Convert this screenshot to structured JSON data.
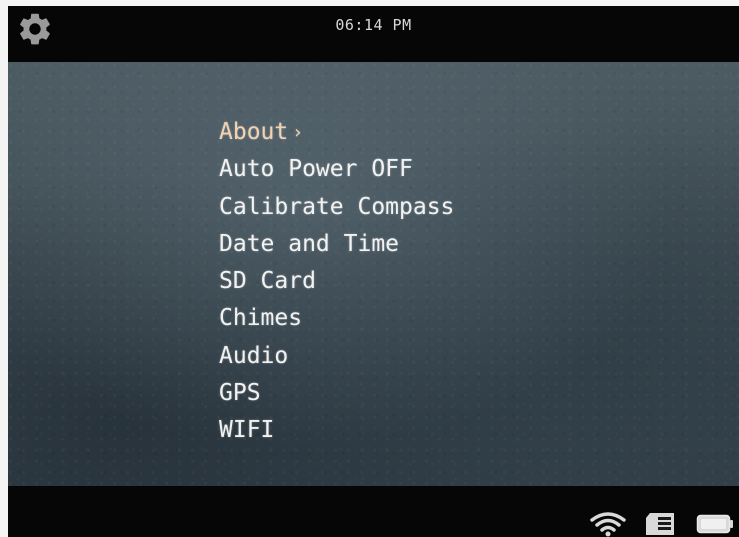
{
  "statusbar": {
    "time": "06:14 PM",
    "settings_icon": "gear-icon"
  },
  "menu": {
    "items": [
      {
        "label": "About",
        "selected": true,
        "indicator": "›"
      },
      {
        "label": "Auto Power OFF"
      },
      {
        "label": "Calibrate Compass"
      },
      {
        "label": "Date and Time"
      },
      {
        "label": "SD Card"
      },
      {
        "label": "Chimes"
      },
      {
        "label": "Audio"
      },
      {
        "label": "GPS"
      },
      {
        "label": "WIFI"
      }
    ],
    "selected_color": "#f1d3b3",
    "item_color": "#f2f2f2"
  },
  "bottom_status": {
    "icons": [
      "wifi-icon",
      "sd-card-icon",
      "battery-icon"
    ]
  }
}
